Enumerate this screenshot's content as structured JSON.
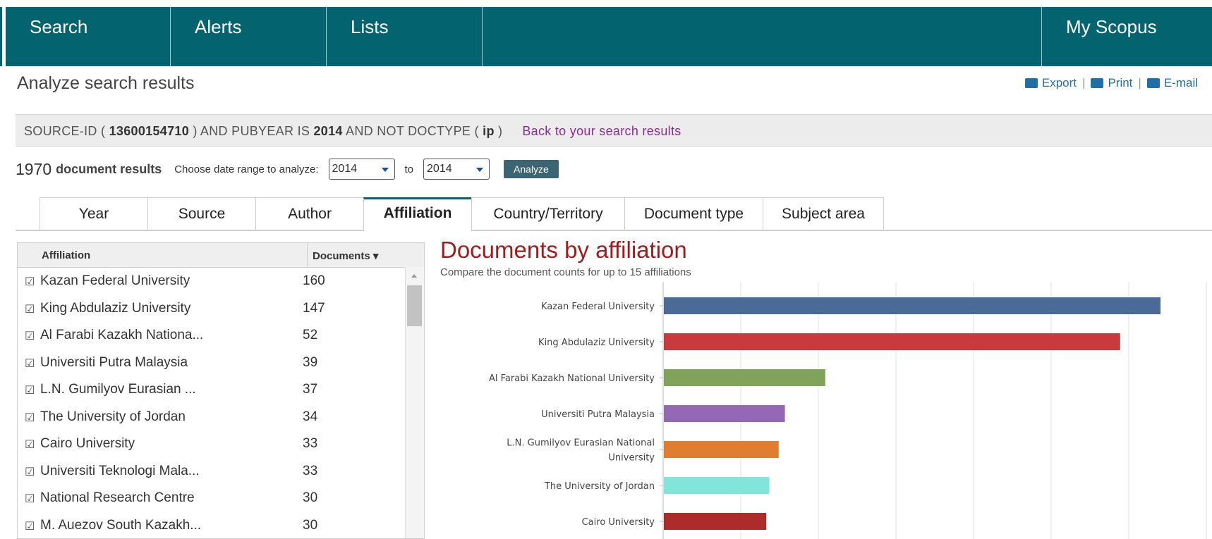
{
  "nav": {
    "items": [
      "Search",
      "Alerts",
      "Lists"
    ],
    "my_scopus": "My Scopus"
  },
  "page_title": "Analyze search results",
  "actions": {
    "export": "Export",
    "print": "Print",
    "email": "E-mail"
  },
  "query": {
    "p1": "SOURCE-ID ( ",
    "source_id": "13600154710",
    "p2": " ) AND PUBYEAR IS ",
    "year": "2014",
    "p3": " AND NOT DOCTYPE ( ",
    "doctype": "ip",
    "p4": " )",
    "back_link": "Back to your search results"
  },
  "results": {
    "count": "1970",
    "label": "document results",
    "range_label": "Choose date range to analyze:",
    "from": "2014",
    "to_label": "to",
    "to": "2014",
    "analyze_button": "Analyze"
  },
  "tabs": [
    "Year",
    "Source",
    "Author",
    "Affiliation",
    "Country/Territory",
    "Document type",
    "Subject area"
  ],
  "active_tab": "Affiliation",
  "table": {
    "col_affiliation": "Affiliation",
    "col_documents": "Documents",
    "rows": [
      {
        "name": "Kazan Federal University",
        "value": "160"
      },
      {
        "name": "King Abdulaziz University",
        "value": "147"
      },
      {
        "name": "Al Farabi Kazakh Nationa...",
        "value": "52"
      },
      {
        "name": "Universiti Putra Malaysia",
        "value": "39"
      },
      {
        "name": "L.N. Gumilyov Eurasian ...",
        "value": "37"
      },
      {
        "name": "The University of Jordan",
        "value": "34"
      },
      {
        "name": "Cairo University",
        "value": "33"
      },
      {
        "name": "Universiti Teknologi Mala...",
        "value": "33"
      },
      {
        "name": "National Research Centre",
        "value": "30"
      },
      {
        "name": "M. Auezov South Kazakh...",
        "value": "30"
      }
    ]
  },
  "chart_title": "Documents by affiliation",
  "chart_subtitle": "Compare the document counts for up to 15 affiliations",
  "chart_data": {
    "type": "bar",
    "orientation": "horizontal",
    "categories": [
      "Kazan Federal University",
      "King Abdulaziz University",
      "Al Farabi Kazakh National University",
      "Universiti Putra Malaysia",
      "L.N. Gumilyov Eurasian National University",
      "The University of Jordan",
      "Cairo University"
    ],
    "values": [
      160,
      147,
      52,
      39,
      37,
      34,
      33
    ],
    "colors": [
      "#4a6b96",
      "#c93a3f",
      "#80a25a",
      "#9468b5",
      "#e17d2e",
      "#7fe6d9",
      "#ad2b2b"
    ],
    "xlim": [
      0,
      175
    ],
    "grid": true
  }
}
